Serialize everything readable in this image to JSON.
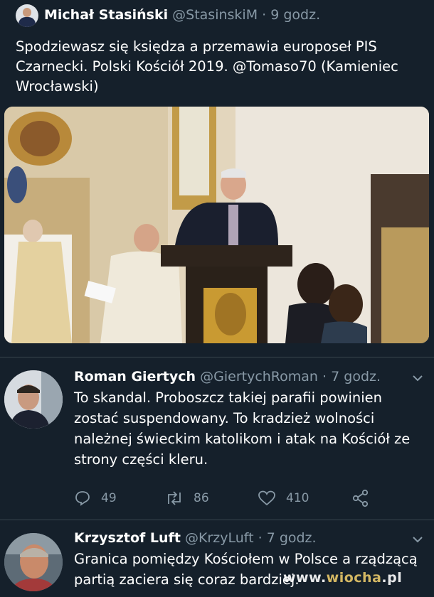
{
  "tweet": {
    "author_name": "Michał Stasiński",
    "author_handle": "@StasinskiM",
    "separator": "·",
    "time": "9 godz.",
    "text_lines": [
      "Spodziewasz się księdza a przemawia europoseł PIS",
      "Czarnecki. Polski Kościół 2019. @Tomaso70 (Kamieniec",
      "Wrocławski)"
    ],
    "image_icon": "church-photo"
  },
  "replies": [
    {
      "author_name": "Roman Giertych",
      "author_handle": "@GiertychRoman",
      "separator": "·",
      "time": "7 godz.",
      "text_lines": [
        "To skandal. Proboszcz takiej parafii powinien",
        "zostać suspendowany. To kradzież wolności",
        "należnej świeckim katolikom i atak na Kościół ze",
        "strony części kleru."
      ],
      "actions": {
        "reply_count": "49",
        "retweet_count": "86",
        "like_count": "410"
      }
    },
    {
      "author_name": "Krzysztof Luft",
      "author_handle": "@KrzyLuft",
      "separator": "·",
      "time": "7 godz.",
      "text_lines": [
        "Granica pomiędzy Kościołem w Polsce a rządzącą",
        "partią zaciera się coraz bardziej."
      ]
    }
  ],
  "watermark": {
    "prefix": "www.",
    "brand": "wiocha",
    "suffix": ".pl"
  },
  "colors": {
    "background": "#15202b",
    "secondary_text": "#8899a6",
    "divider": "#38444d"
  }
}
